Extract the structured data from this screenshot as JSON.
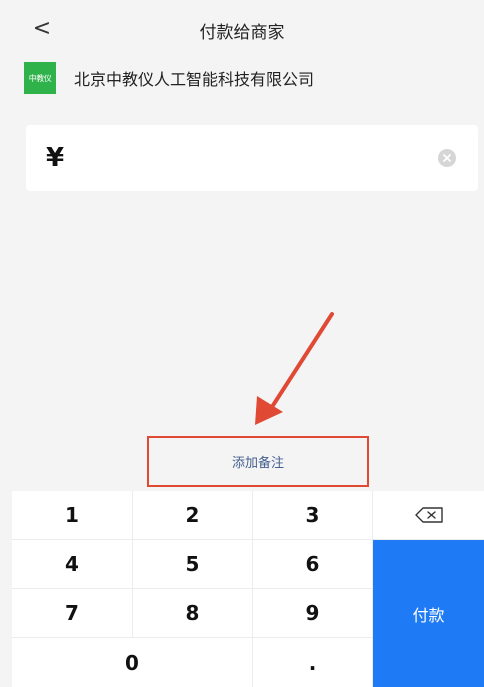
{
  "header": {
    "back_symbol": "<",
    "title": "付款给商家"
  },
  "merchant": {
    "logo_text": "中教仪",
    "name": "北京中教仪人工智能科技有限公司"
  },
  "amount": {
    "currency_symbol": "¥",
    "value": ""
  },
  "remark": {
    "label": "添加备注"
  },
  "keypad": {
    "keys": [
      "1",
      "2",
      "3",
      "4",
      "5",
      "6",
      "7",
      "8",
      "9",
      "0",
      "."
    ],
    "pay_label": "付款"
  },
  "colors": {
    "logo_green": "#2fb24a",
    "pay_blue": "#1f7bf5",
    "annotation_red": "#e04a35",
    "link_blue": "#46608f"
  }
}
